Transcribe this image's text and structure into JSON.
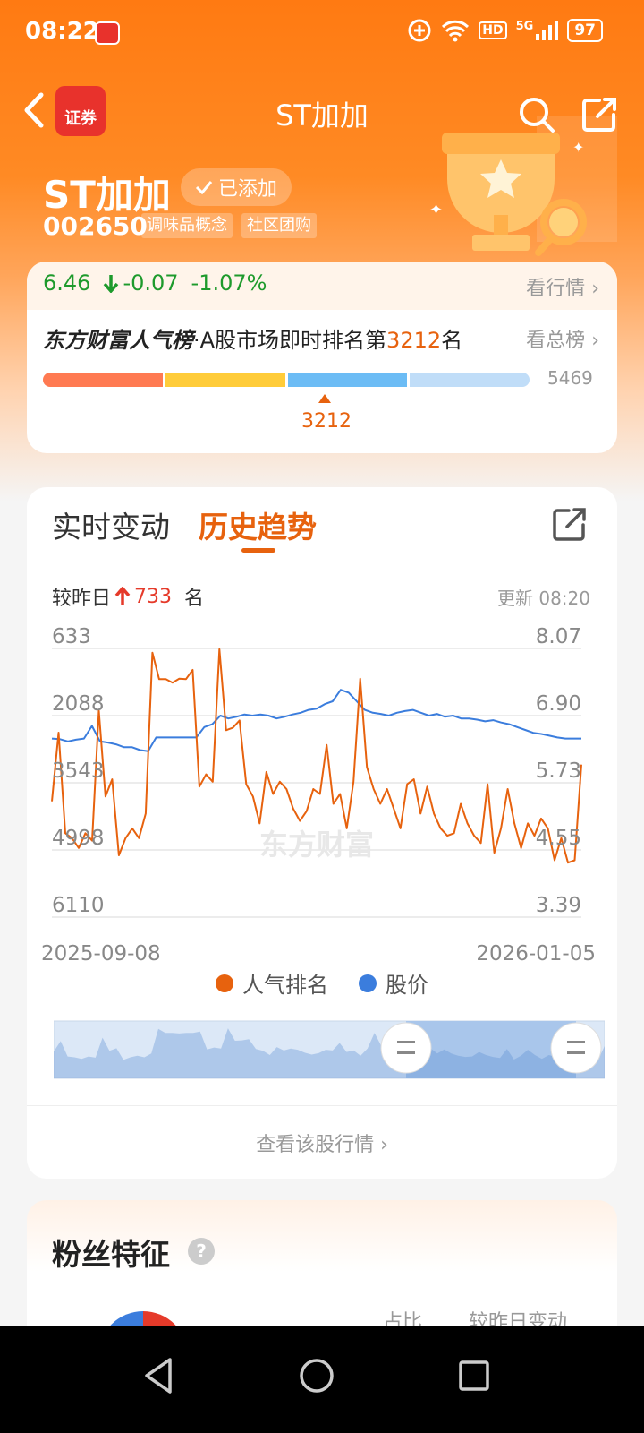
{
  "status_bar": {
    "time": "08:22",
    "battery": "97",
    "network": "5G",
    "hd": "HD",
    "icons": [
      "plus-circle-icon",
      "wifi-icon",
      "hd-icon",
      "signal-icon",
      "battery-icon"
    ]
  },
  "nav": {
    "title": "ST加加",
    "app_logo": "证券"
  },
  "stock": {
    "name": "ST加加",
    "added_label": "已添加",
    "code": "002650",
    "tags": [
      "调味品概念",
      "社区团购"
    ],
    "price": "6.46",
    "change": "-0.07",
    "change_pct": "-1.07%",
    "quote_link": "看行情"
  },
  "rank": {
    "brand": "东方财富人气榜",
    "text_prefix": "·A股市场即时排名第",
    "rank": "3212",
    "text_suffix": "名",
    "all_link": "看总榜",
    "total": "5469",
    "current": "3212",
    "progress_fraction": 0.587
  },
  "trend": {
    "tab_realtime": "实时变动",
    "tab_history": "历史趋势",
    "change_label": "较昨日",
    "change_value": "733",
    "change_unit": "名",
    "updated": "更新 08:20",
    "watermark": "东方财富",
    "view_quote": "查看该股行情"
  },
  "colors": {
    "accent": "#e7620e",
    "price_line": "#3b7ddd",
    "rank_line": "#e7620e",
    "down": "#1e9a2c",
    "up": "#e53a2a"
  },
  "chart_data": {
    "type": "line",
    "x_start": "2025-09-08",
    "x_end": "2026-01-05",
    "y_left_ticks": [
      "633",
      "2088",
      "3543",
      "4998",
      "6110"
    ],
    "y_right_ticks": [
      "8.07",
      "6.90",
      "5.73",
      "4.55",
      "3.39"
    ],
    "y_left_range": [
      633,
      6110
    ],
    "y_left_inverted": true,
    "y_right_range": [
      3.39,
      8.07
    ],
    "series": [
      {
        "name": "人气排名",
        "axis": "left",
        "values": [
          3750,
          2350,
          4400,
          4500,
          4700,
          4400,
          4550,
          1900,
          3650,
          3300,
          4850,
          4500,
          4300,
          4500,
          4000,
          720,
          1260,
          1260,
          1330,
          1250,
          1260,
          1070,
          3450,
          3200,
          3350,
          650,
          2300,
          2250,
          2100,
          3400,
          3650,
          4200,
          3150,
          3600,
          3350,
          3500,
          3900,
          4150,
          3950,
          3500,
          3600,
          2600,
          3800,
          3600,
          4300,
          3350,
          1250,
          3050,
          3500,
          3800,
          3500,
          3900,
          4300,
          3400,
          3300,
          4000,
          3450,
          4000,
          4300,
          4450,
          4400,
          3800,
          4200,
          4450,
          4600,
          3400,
          4800,
          4300,
          3500,
          4200,
          4700,
          4200,
          4450,
          4100,
          4300,
          4950,
          4500,
          5000,
          4950,
          3000
        ]
      },
      {
        "name": "股价",
        "axis": "right",
        "values": [
          6.5,
          6.49,
          6.45,
          6.48,
          6.5,
          6.72,
          6.45,
          6.43,
          6.4,
          6.35,
          6.35,
          6.3,
          6.28,
          6.52,
          6.52,
          6.52,
          6.52,
          6.52,
          6.52,
          6.7,
          6.75,
          6.9,
          6.85,
          6.88,
          6.92,
          6.9,
          6.92,
          6.9,
          6.85,
          6.88,
          6.92,
          6.95,
          7.0,
          7.02,
          7.1,
          7.15,
          7.35,
          7.3,
          7.15,
          7.0,
          6.95,
          6.93,
          6.9,
          6.95,
          6.98,
          7.0,
          6.95,
          6.9,
          6.93,
          6.88,
          6.9,
          6.85,
          6.85,
          6.83,
          6.8,
          6.82,
          6.78,
          6.75,
          6.7,
          6.65,
          6.6,
          6.58,
          6.55,
          6.52,
          6.5,
          6.5,
          6.5
        ]
      }
    ],
    "grid": true,
    "legend": "bottom-center"
  },
  "fans": {
    "title": "粉丝特征",
    "col_share": "占比",
    "col_change": "较昨日变动"
  }
}
